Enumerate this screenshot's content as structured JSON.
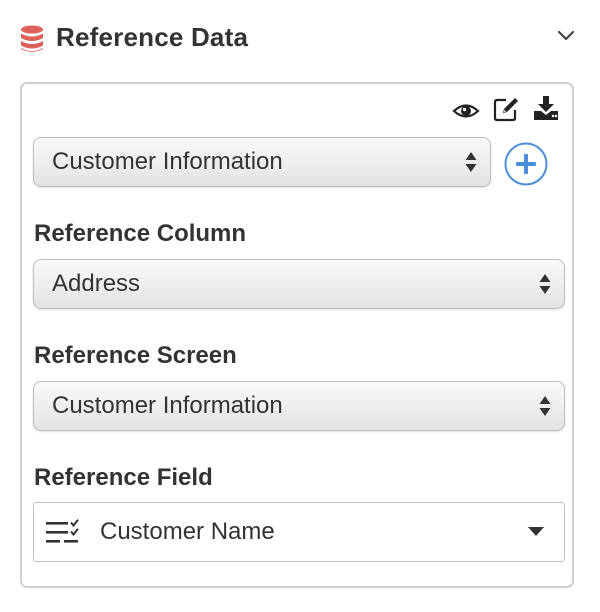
{
  "header": {
    "title": "Reference Data",
    "title_icon": "database-icon",
    "collapse_icon": "chevron-down-icon"
  },
  "toolbar": {
    "icons": [
      "eye-icon",
      "edit-icon",
      "download-icon"
    ]
  },
  "source": {
    "selected": "Customer Information",
    "add_icon": "plus-circle-icon"
  },
  "reference_column": {
    "label": "Reference Column",
    "selected": "Address"
  },
  "reference_screen": {
    "label": "Reference Screen",
    "selected": "Customer Information"
  },
  "reference_field": {
    "label": "Reference Field",
    "selected": "Customer Name",
    "field_icon": "list-check-icon"
  },
  "colors": {
    "database_icon": "#e0605a",
    "add_button": "#4a90d9",
    "text": "#333333",
    "border": "#cfcfcf"
  }
}
